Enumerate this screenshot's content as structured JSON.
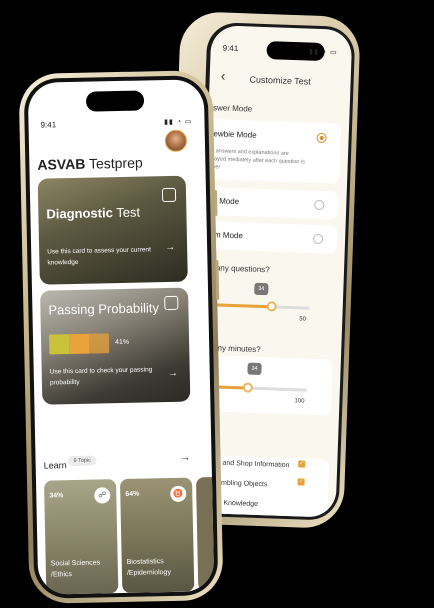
{
  "back_phone": {
    "status_time": "9:41",
    "nav_title": "Customize Test",
    "answer_mode_title": "nswer Mode",
    "options": [
      {
        "label": "Newbie Mode",
        "selected": true,
        "description": "rrect answers and explanations are displayed mediately after each question is answer"
      },
      {
        "label": "Fast Mode",
        "selected": false
      },
      {
        "label": "Exam Mode",
        "selected": false
      }
    ],
    "questions_label": "y many questions?",
    "questions_slider": {
      "value": "34",
      "max": "50",
      "fraction": 0.68
    },
    "minutes_label": "y many minutes?",
    "minutes_slider": {
      "value": "34",
      "max": "100",
      "fraction": 0.5
    },
    "subjects_title": "jects",
    "subjects": [
      "Auto and Shop Information",
      "Assembling Objects",
      "Word Knowledge"
    ]
  },
  "front_phone": {
    "status_time": "9:41",
    "app_title_bold": "ASVAB",
    "app_title_rest": " Testprep",
    "diagnostic": {
      "title_bold": "Diagnostic",
      "title_rest": " Test",
      "text": "Use this card to assess your current knowledge"
    },
    "passing": {
      "title": "Passing Probability",
      "percent": "41%",
      "text": "Use this card to check your passing probability"
    },
    "learn_label": "Learn",
    "topic_count": "9 Topic",
    "topics": [
      {
        "percent": "34%",
        "name": "Social Sciences /Ethics",
        "icon": "brain-icon"
      },
      {
        "percent": "64%",
        "name": "Biostatistics /Epidemiology",
        "icon": "lungs-icon"
      }
    ]
  },
  "colors": {
    "accent": "#e8a23a",
    "card_dark": "#5c5840",
    "lime": "#c9c23a"
  }
}
